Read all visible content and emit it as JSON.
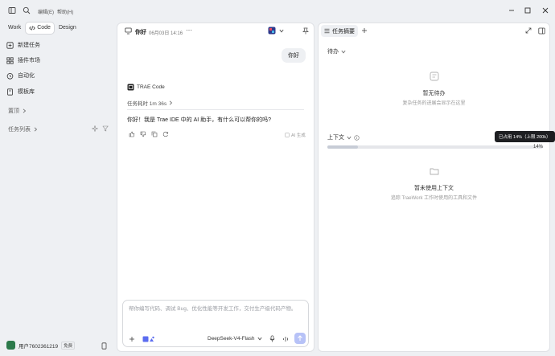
{
  "titlebar": {
    "menus": [
      "编辑(E)",
      "帮助(H)"
    ]
  },
  "sidebar": {
    "modes": [
      {
        "label": "Work"
      },
      {
        "label": "Code"
      },
      {
        "label": "Design"
      }
    ],
    "items": [
      {
        "label": "新建任务"
      },
      {
        "label": "插件市场"
      },
      {
        "label": "自动化"
      },
      {
        "label": "模板库"
      }
    ],
    "sections": {
      "favorites": "置顶",
      "tasks": "任务列表"
    },
    "user": {
      "name": "用户7602361219",
      "plan": "免费"
    }
  },
  "chat": {
    "header": {
      "title": "你好",
      "timestamp": "06月03日 14:16"
    },
    "user_message": "你好",
    "assistant": {
      "name": "TRAE Code",
      "duration_label": "任务耗时 1m 36s",
      "message": "你好！我是 Trae IDE 中的 AI 助手，有什么可以帮你的吗?",
      "ai_tag": "AI 生成"
    },
    "input": {
      "placeholder": "帮你编写代码、调试 Bug、优化性能等开发工作，交付生产级代码产物。",
      "model": "DeepSeek-V4-Flash"
    }
  },
  "right": {
    "tab_label": "任务摘要",
    "todo": {
      "header": "待办",
      "empty_title": "暂无待办",
      "empty_desc": "复杂任务的进展会显示在这里"
    },
    "context": {
      "header": "上下文",
      "tooltip": "已占用 14%（上限 200k）",
      "percent_label": "14%",
      "usage_fraction": 0.14,
      "empty_title": "暂未使用上下文",
      "empty_desc": "追踪 TraeWork 工作时使用的工具和文件"
    }
  },
  "colors": {
    "accent": "#5b6cf0",
    "send_disabled": "#b7c2f7",
    "avatar_green": "#2c7a4b"
  }
}
